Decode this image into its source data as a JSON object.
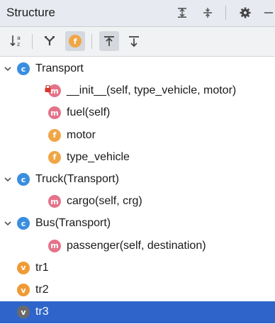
{
  "panel": {
    "title": "Structure"
  },
  "header_buttons": [
    {
      "name": "expand-all-icon"
    },
    {
      "name": "collapse-all-icon"
    },
    {
      "name": "gear-icon"
    },
    {
      "name": "hide-panel-icon"
    }
  ],
  "toolbar": {
    "sort_alpha_glyph": "↓a z",
    "filter_glyph": "Y",
    "fields_badge": "f",
    "autoscroll_to_source": "",
    "autoscroll_from_source": ""
  },
  "tree": [
    {
      "depth": 0,
      "expanded": true,
      "kind": "c",
      "badge": "c",
      "label": "Transport"
    },
    {
      "depth": 1,
      "kind": "m",
      "badge": "m",
      "label": "__init__(self, type_vehicle, motor)",
      "locked": true
    },
    {
      "depth": 1,
      "kind": "m",
      "badge": "m",
      "label": "fuel(self)"
    },
    {
      "depth": 1,
      "kind": "f",
      "badge": "f",
      "label": "motor"
    },
    {
      "depth": 1,
      "kind": "f",
      "badge": "f",
      "label": "type_vehicle"
    },
    {
      "depth": 0,
      "expanded": true,
      "kind": "c",
      "badge": "c",
      "label": "Truck(Transport)"
    },
    {
      "depth": 1,
      "kind": "m",
      "badge": "m",
      "label": "cargo(self, crg)"
    },
    {
      "depth": 0,
      "expanded": true,
      "kind": "c",
      "badge": "c",
      "label": "Bus(Transport)"
    },
    {
      "depth": 1,
      "kind": "m",
      "badge": "m",
      "label": "passenger(self, destination)"
    },
    {
      "depth": 0,
      "kind": "v",
      "badge": "v",
      "label": "tr1"
    },
    {
      "depth": 0,
      "kind": "v",
      "badge": "v",
      "label": "tr2"
    },
    {
      "depth": 0,
      "kind": "v",
      "badge": "v",
      "label": "tr3",
      "selected": true
    }
  ],
  "colors": {
    "class_badge": "#3a8ee0",
    "method_badge": "#e4738a",
    "field_badge": "#f0a646",
    "variable_badge": "#f09a36",
    "selection": "#2f65ca"
  }
}
